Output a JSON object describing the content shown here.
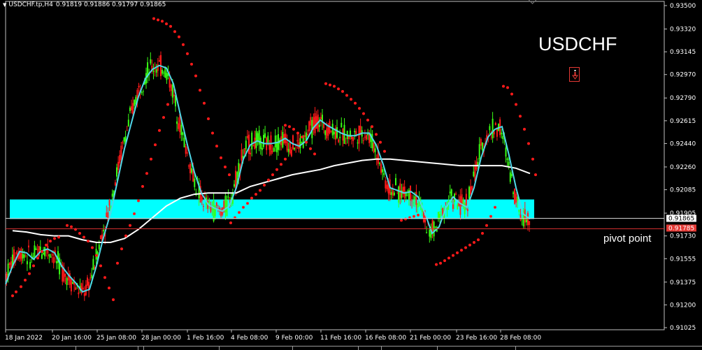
{
  "header": {
    "symbol_tf": "USDCHF.tp,H4",
    "ohlc": "0.91819 0.91886 0.91797 0.91865"
  },
  "overlay": {
    "symbol": "USDCHF",
    "pivot_label": "pivot point"
  },
  "colors": {
    "background": "#000000",
    "bull": "#39ff14",
    "bear": "#ff1a1a",
    "psar": "#ff1a1a",
    "fast_ma": "#4fd8e8",
    "slow_ma": "#ffffff",
    "zone": "#00ffff",
    "bid_line": "#cfcfcf",
    "pivot_line": "#d32f2f",
    "axis": "#c0c0c0",
    "grid_text": "#ffffff"
  },
  "chart_data": {
    "type": "candlestick",
    "y_ticks": [
      "0.93500",
      "0.93320",
      "0.93145",
      "0.92970",
      "0.92790",
      "0.92615",
      "0.92440",
      "0.92260",
      "0.92085",
      "0.91905",
      "0.91730",
      "0.91555",
      "0.91375",
      "0.91200",
      "0.91025"
    ],
    "ylim": [
      0.91025,
      0.935
    ],
    "x_ticks": [
      "18 Jan 2022",
      "20 Jan 16:00",
      "25 Jan 08:00",
      "28 Jan 00:00",
      "1 Feb 16:00",
      "4 Feb 08:00",
      "9 Feb 00:00",
      "11 Feb 16:00",
      "16 Feb 08:00",
      "21 Feb 00:00",
      "23 Feb 16:00",
      "28 Feb 08:00"
    ],
    "current_price": "0.91865",
    "pivot_price": "0.91785",
    "resistance_zone": [
      0.9186,
      0.9201
    ],
    "fast_ma": [
      [
        0,
        0.9136
      ],
      [
        10,
        0.915
      ],
      [
        20,
        0.9161
      ],
      [
        30,
        0.916
      ],
      [
        40,
        0.9155
      ],
      [
        50,
        0.9161
      ],
      [
        60,
        0.9163
      ],
      [
        70,
        0.916
      ],
      [
        80,
        0.915
      ],
      [
        90,
        0.9143
      ],
      [
        100,
        0.9137
      ],
      [
        110,
        0.913
      ],
      [
        120,
        0.9132
      ],
      [
        130,
        0.915
      ],
      [
        140,
        0.9172
      ],
      [
        150,
        0.919
      ],
      [
        160,
        0.9215
      ],
      [
        170,
        0.924
      ],
      [
        180,
        0.926
      ],
      [
        190,
        0.928
      ],
      [
        200,
        0.9294
      ],
      [
        210,
        0.9301
      ],
      [
        220,
        0.9304
      ],
      [
        230,
        0.9302
      ],
      [
        240,
        0.929
      ],
      [
        250,
        0.9266
      ],
      [
        260,
        0.9243
      ],
      [
        270,
        0.9222
      ],
      [
        280,
        0.9206
      ],
      [
        290,
        0.9197
      ],
      [
        300,
        0.9194
      ],
      [
        310,
        0.9192
      ],
      [
        320,
        0.9196
      ],
      [
        330,
        0.921
      ],
      [
        340,
        0.9232
      ],
      [
        350,
        0.9243
      ],
      [
        360,
        0.9246
      ],
      [
        370,
        0.9244
      ],
      [
        380,
        0.9244
      ],
      [
        390,
        0.9245
      ],
      [
        400,
        0.9248
      ],
      [
        410,
        0.9244
      ],
      [
        420,
        0.9242
      ],
      [
        430,
        0.9246
      ],
      [
        440,
        0.9256
      ],
      [
        450,
        0.9262
      ],
      [
        460,
        0.9258
      ],
      [
        470,
        0.9255
      ],
      [
        480,
        0.9252
      ],
      [
        490,
        0.925
      ],
      [
        500,
        0.925
      ],
      [
        510,
        0.9252
      ],
      [
        520,
        0.9252
      ],
      [
        530,
        0.9243
      ],
      [
        540,
        0.9228
      ],
      [
        550,
        0.921
      ],
      [
        560,
        0.9208
      ],
      [
        570,
        0.9206
      ],
      [
        580,
        0.9207
      ],
      [
        590,
        0.9203
      ],
      [
        600,
        0.919
      ],
      [
        610,
        0.9175
      ],
      [
        620,
        0.918
      ],
      [
        630,
        0.9195
      ],
      [
        640,
        0.9203
      ],
      [
        650,
        0.9198
      ],
      [
        660,
        0.9195
      ],
      [
        670,
        0.921
      ],
      [
        680,
        0.9233
      ],
      [
        690,
        0.9249
      ],
      [
        700,
        0.9255
      ],
      [
        710,
        0.9257
      ],
      [
        720,
        0.9235
      ],
      [
        730,
        0.921
      ],
      [
        740,
        0.919
      ],
      [
        750,
        0.9186
      ]
    ],
    "slow_ma": [
      [
        10,
        0.9177
      ],
      [
        30,
        0.9176
      ],
      [
        50,
        0.9174
      ],
      [
        70,
        0.9173
      ],
      [
        90,
        0.9173
      ],
      [
        110,
        0.917
      ],
      [
        130,
        0.9168
      ],
      [
        150,
        0.9168
      ],
      [
        170,
        0.9171
      ],
      [
        190,
        0.9178
      ],
      [
        210,
        0.9187
      ],
      [
        230,
        0.9196
      ],
      [
        250,
        0.9202
      ],
      [
        270,
        0.9205
      ],
      [
        290,
        0.9206
      ],
      [
        310,
        0.9206
      ],
      [
        330,
        0.9206
      ],
      [
        350,
        0.9211
      ],
      [
        370,
        0.9214
      ],
      [
        390,
        0.9217
      ],
      [
        410,
        0.922
      ],
      [
        430,
        0.9222
      ],
      [
        450,
        0.9224
      ],
      [
        470,
        0.9227
      ],
      [
        490,
        0.9229
      ],
      [
        510,
        0.9231
      ],
      [
        530,
        0.9232
      ],
      [
        550,
        0.9232
      ],
      [
        570,
        0.9231
      ],
      [
        590,
        0.923
      ],
      [
        610,
        0.9229
      ],
      [
        630,
        0.9228
      ],
      [
        650,
        0.9227
      ],
      [
        670,
        0.9227
      ],
      [
        690,
        0.9227
      ],
      [
        710,
        0.9227
      ],
      [
        730,
        0.9225
      ],
      [
        750,
        0.9221
      ]
    ],
    "psar": [
      [
        [
          10,
          0.9127
        ],
        [
          15,
          0.913
        ],
        [
          22,
          0.9134
        ],
        [
          28,
          0.9139
        ],
        [
          34,
          0.9144
        ],
        [
          40,
          0.915
        ],
        [
          46,
          0.9156
        ],
        [
          52,
          0.9161
        ],
        [
          58,
          0.9166
        ],
        [
          64,
          0.9169
        ],
        [
          70,
          0.9171
        ],
        [
          76,
          0.9172
        ]
      ],
      [
        [
          88,
          0.9181
        ],
        [
          94,
          0.918
        ],
        [
          100,
          0.9178
        ],
        [
          106,
          0.9175
        ],
        [
          112,
          0.9172
        ],
        [
          118,
          0.9169
        ],
        [
          124,
          0.9164
        ],
        [
          130,
          0.9158
        ],
        [
          136,
          0.915
        ],
        [
          142,
          0.9141
        ],
        [
          148,
          0.9133
        ],
        [
          154,
          0.9124
        ]
      ],
      [
        [
          160,
          0.9152
        ],
        [
          166,
          0.9163
        ],
        [
          172,
          0.9173
        ],
        [
          178,
          0.9181
        ],
        [
          184,
          0.919
        ],
        [
          190,
          0.92
        ],
        [
          196,
          0.9211
        ],
        [
          202,
          0.9221
        ],
        [
          208,
          0.9232
        ],
        [
          214,
          0.9243
        ],
        [
          220,
          0.9254
        ],
        [
          226,
          0.9264
        ],
        [
          232,
          0.9274
        ]
      ],
      [
        [
          212,
          0.934
        ],
        [
          218,
          0.9339
        ],
        [
          224,
          0.9338
        ],
        [
          230,
          0.9336
        ],
        [
          236,
          0.9334
        ],
        [
          242,
          0.933
        ],
        [
          248,
          0.9326
        ],
        [
          254,
          0.932
        ],
        [
          260,
          0.9313
        ],
        [
          266,
          0.9305
        ],
        [
          272,
          0.9296
        ],
        [
          278,
          0.9285
        ],
        [
          284,
          0.9275
        ],
        [
          290,
          0.9263
        ],
        [
          296,
          0.9252
        ],
        [
          302,
          0.9242
        ],
        [
          308,
          0.9233
        ],
        [
          314,
          0.9226
        ],
        [
          320,
          0.922
        ]
      ],
      [
        [
          322,
          0.9183
        ],
        [
          328,
          0.9187
        ],
        [
          334,
          0.9191
        ],
        [
          340,
          0.9195
        ],
        [
          346,
          0.9198
        ],
        [
          352,
          0.9202
        ],
        [
          358,
          0.9205
        ],
        [
          364,
          0.9208
        ],
        [
          370,
          0.9212
        ],
        [
          376,
          0.9216
        ],
        [
          382,
          0.922
        ],
        [
          388,
          0.9224
        ],
        [
          394,
          0.9228
        ],
        [
          400,
          0.9232
        ]
      ],
      [
        [
          400,
          0.9258
        ],
        [
          406,
          0.9257
        ],
        [
          412,
          0.9255
        ],
        [
          418,
          0.9252
        ],
        [
          424,
          0.9249
        ],
        [
          430,
          0.9245
        ],
        [
          436,
          0.924
        ],
        [
          442,
          0.9236
        ]
      ],
      [
        [
          458,
          0.929
        ],
        [
          464,
          0.9289
        ],
        [
          470,
          0.9288
        ],
        [
          476,
          0.9286
        ],
        [
          482,
          0.9284
        ],
        [
          488,
          0.9281
        ],
        [
          494,
          0.9278
        ],
        [
          500,
          0.9275
        ],
        [
          506,
          0.9271
        ],
        [
          512,
          0.9267
        ],
        [
          518,
          0.9262
        ],
        [
          524,
          0.9257
        ],
        [
          530,
          0.9251
        ],
        [
          536,
          0.9245
        ],
        [
          542,
          0.9238
        ]
      ],
      [
        [
          566,
          0.9185
        ],
        [
          572,
          0.9186
        ],
        [
          578,
          0.9187
        ],
        [
          584,
          0.9188
        ],
        [
          590,
          0.9189
        ]
      ],
      [
        [
          616,
          0.9151
        ],
        [
          622,
          0.9152
        ],
        [
          628,
          0.9154
        ],
        [
          634,
          0.9156
        ],
        [
          640,
          0.9158
        ],
        [
          646,
          0.916
        ],
        [
          652,
          0.9162
        ],
        [
          658,
          0.9164
        ],
        [
          664,
          0.9166
        ],
        [
          670,
          0.9168
        ],
        [
          676,
          0.917
        ],
        [
          682,
          0.9175
        ],
        [
          688,
          0.9181
        ],
        [
          694,
          0.9188
        ],
        [
          700,
          0.9195
        ]
      ],
      [
        [
          712,
          0.9288
        ],
        [
          718,
          0.9287
        ],
        [
          724,
          0.9282
        ],
        [
          730,
          0.9274
        ],
        [
          736,
          0.9265
        ],
        [
          742,
          0.9255
        ],
        [
          748,
          0.9244
        ],
        [
          754,
          0.9232
        ],
        [
          758,
          0.922
        ]
      ]
    ]
  }
}
